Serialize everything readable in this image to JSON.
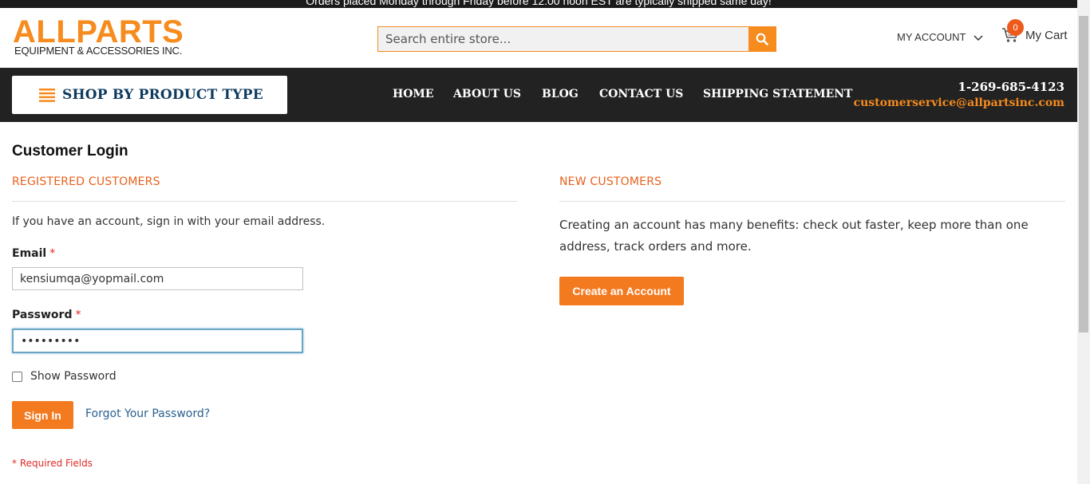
{
  "topbar": {
    "notice": "Orders placed Monday through Friday before 12:00 noon EST are typically shipped same day!"
  },
  "logo": {
    "main": "ALLPARTS",
    "sub": "EQUIPMENT & ACCESSORIES INC."
  },
  "search": {
    "placeholder": "Search entire store..."
  },
  "header": {
    "account_label": "MY ACCOUNT",
    "cart_label": "My Cart",
    "cart_count": "0"
  },
  "nav": {
    "shop_label": "SHOP BY PRODUCT TYPE",
    "items": [
      "HOME",
      "ABOUT US",
      "BLOG",
      "CONTACT US",
      "SHIPPING STATEMENT"
    ],
    "phone": "1-269-685-4123",
    "email": "customerservice@allpartsinc.com"
  },
  "page": {
    "title": "Customer Login"
  },
  "registered": {
    "title": "REGISTERED CUSTOMERS",
    "intro": "If you have an account, sign in with your email address.",
    "email_label": "Email",
    "email_value": "kensiumqa@yopmail.com",
    "password_label": "Password",
    "password_value": "•••••••••",
    "required_mark": "*",
    "show_password": "Show Password",
    "signin": "Sign In",
    "forgot": "Forgot Your Password?",
    "required_fields": "* Required Fields"
  },
  "new_customers": {
    "title": "NEW CUSTOMERS",
    "text": "Creating an account has many benefits: check out faster, keep more than one address, track orders and more.",
    "create_button": "Create an Account"
  },
  "colors": {
    "accent": "#f68b1e",
    "button": "#f47a20",
    "nav_bg": "#222222",
    "section_title": "#e8621c",
    "required": "#e02b27"
  },
  "icons": [
    "search-icon",
    "chevron-down-icon",
    "cart-icon",
    "hamburger-icon"
  ]
}
